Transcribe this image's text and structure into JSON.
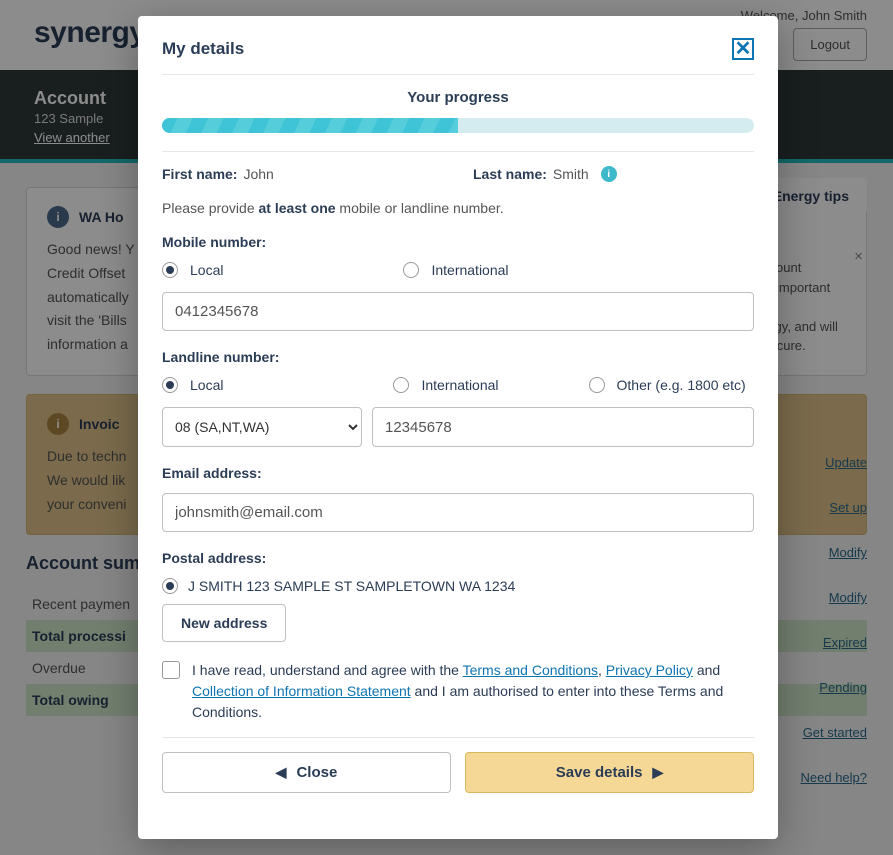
{
  "background": {
    "logo_text": "synergy",
    "welcome": "Welcome, John Smith",
    "logout": "Logout",
    "account_header_title": "Account",
    "account_address": "123 Sample",
    "view_another": "View another",
    "energy_tips": "Energy tips",
    "alert1": {
      "title": "WA Ho",
      "body": "Good news! Y\nCredit Offset\nautomatically\nvisit the 'Bills\ninformation a"
    },
    "alert2": {
      "title": "Invoic",
      "body": "Due to techn\nWe would lik\nyour conveni"
    },
    "right_text": "ccount\nis important\nr\nergy, and will\nsecure.",
    "right_links": [
      "Update",
      "Set up",
      "Modify",
      "Modify",
      "Expired",
      "Pending",
      "Get started",
      "Need help?"
    ],
    "summary_title": "Account sum",
    "summary_rows": {
      "recent": "Recent paymen",
      "processing": "Total processi",
      "overdue": "Overdue",
      "owing": "Total owing"
    },
    "small_x": "×"
  },
  "modal": {
    "title": "My details",
    "progress_label": "Your progress",
    "first_name_label": "First name:",
    "first_name_value": "John",
    "last_name_label": "Last name:",
    "last_name_value": "Smith",
    "instruction_prefix": "Please provide ",
    "instruction_bold": "at least one",
    "instruction_suffix": " mobile or landline number.",
    "mobile_label": "Mobile number:",
    "mobile_opts": {
      "local": "Local",
      "intl": "International"
    },
    "mobile_value": "0412345678",
    "landline_label": "Landline number:",
    "landline_opts": {
      "local": "Local",
      "intl": "International",
      "other": "Other (e.g. 1800 etc)"
    },
    "area_code_selected": "08 (SA,NT,WA)",
    "landline_value": "12345678",
    "email_label": "Email address:",
    "email_value": "johnsmith@email.com",
    "postal_label": "Postal address:",
    "postal_value": "J SMITH 123 SAMPLE ST SAMPLETOWN WA 1234",
    "new_address": "New address",
    "consent_1": "I have read, understand and agree with the ",
    "consent_link_tc": "Terms and Conditions",
    "consent_2": ", ",
    "consent_link_pp": "Privacy Policy",
    "consent_3": " and ",
    "consent_link_cis": "Collection of Information Statement",
    "consent_4": " and I am authorised to enter into these Terms and Conditions.",
    "close_label": "Close",
    "save_label": "Save details"
  }
}
